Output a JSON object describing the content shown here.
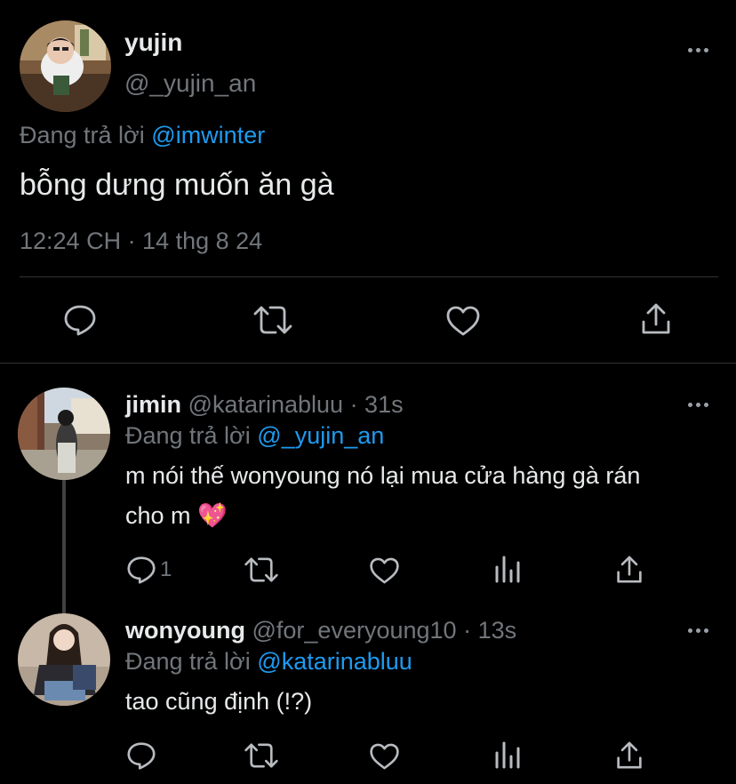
{
  "main_tweet": {
    "display_name": "yujin",
    "handle": "@_yujin_an",
    "reply_prefix": "Đang trả lời",
    "reply_to": "@imwinter",
    "text": "bỗng dưng muốn ăn gà",
    "timestamp": "12:24 CH · 14 thg 8 24"
  },
  "replies": [
    {
      "display_name": "jimin",
      "handle": "@katarinabluu",
      "time": "· 31s",
      "reply_prefix": "Đang trả lời",
      "reply_to": "@_yujin_an",
      "text_line1": "m nói thế wonyoung nó lại mua cửa hàng gà rán",
      "text_line2": "cho m",
      "emoji": "💖",
      "reply_count": "1"
    },
    {
      "display_name": "wonyoung",
      "handle": "@for_everyoung10",
      "time": "· 13s",
      "reply_prefix": "Đang trả lời",
      "reply_to": "@katarinabluu",
      "text": "tao cũng định (!?)"
    }
  ],
  "icons": [
    "comment-icon",
    "retweet-icon",
    "heart-icon",
    "share-icon",
    "analytics-icon",
    "more-icon"
  ],
  "colors": {
    "background": "#000000",
    "text": "#e7e9ea",
    "secondary": "#71767b",
    "link": "#1d9bf0",
    "divider": "#2f3336"
  }
}
